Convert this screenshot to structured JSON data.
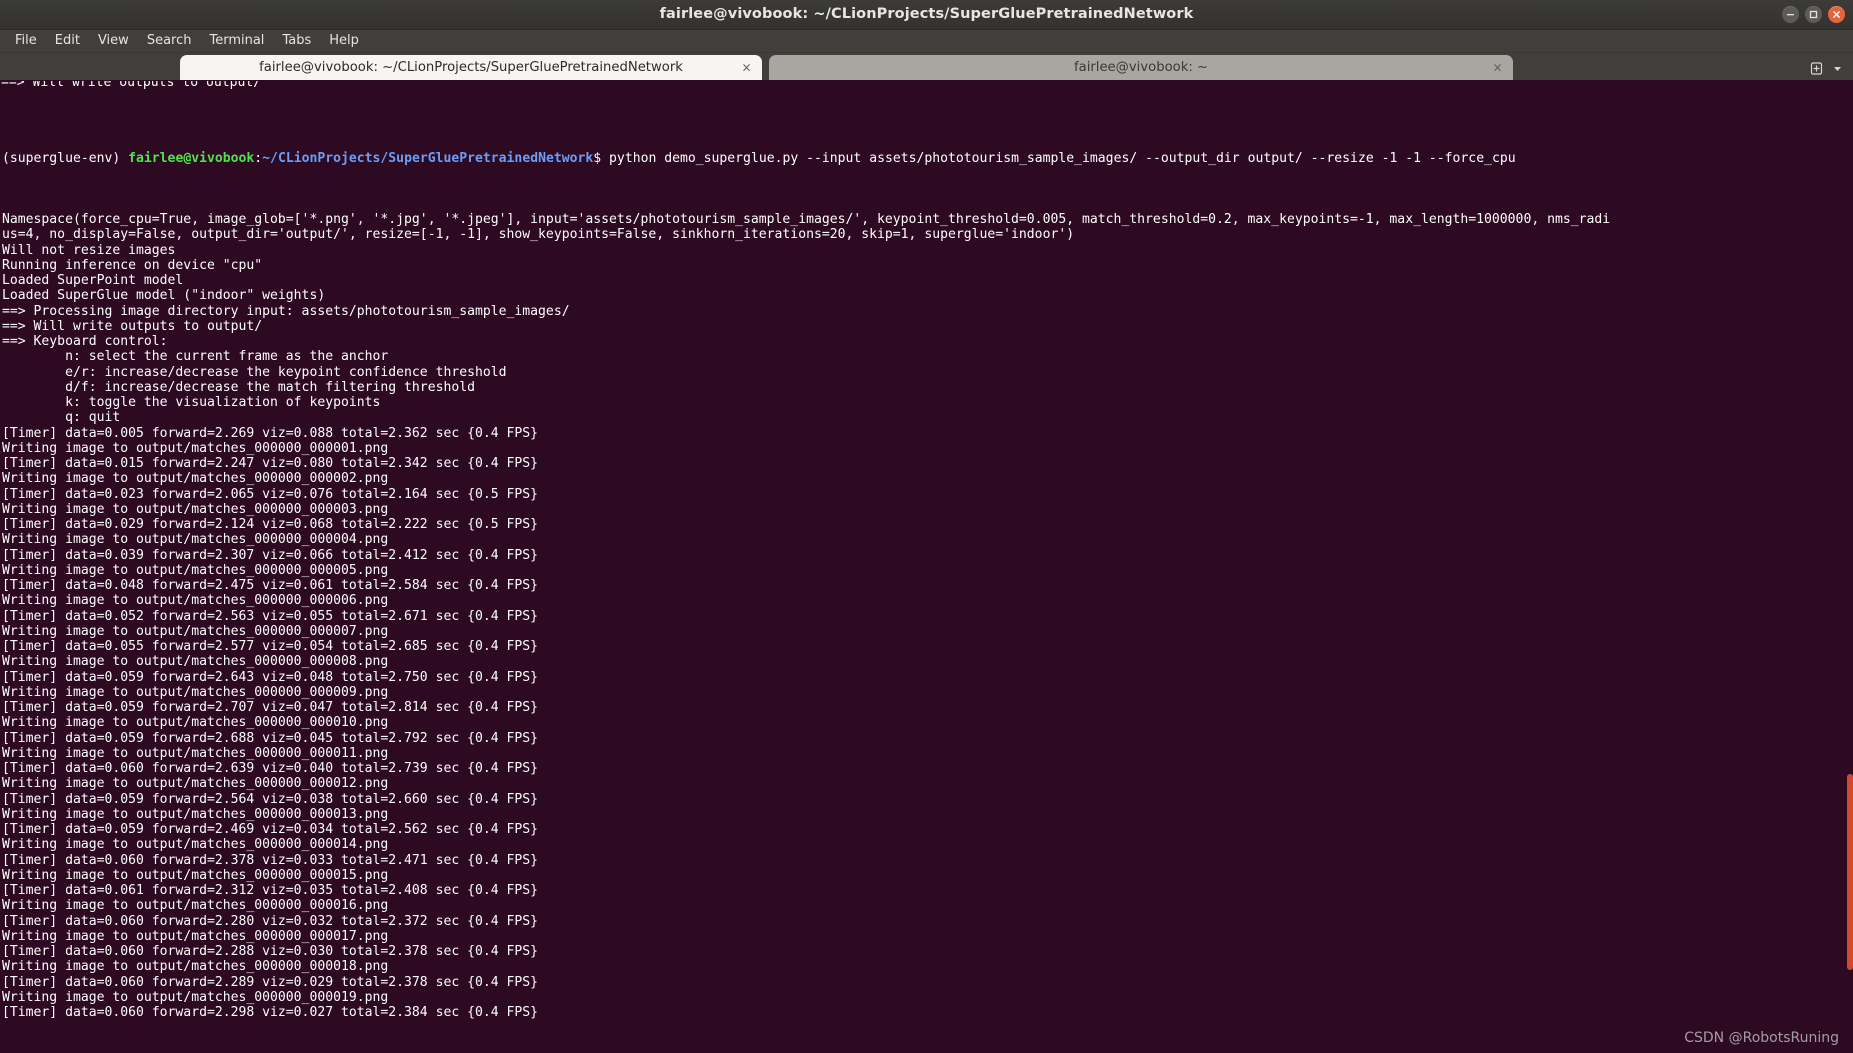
{
  "window": {
    "title": "fairlee@vivobook: ~/CLionProjects/SuperGluePretrainedNetwork",
    "controls": {
      "minimize": "minimize",
      "maximize": "maximize",
      "close": "close"
    }
  },
  "menubar": {
    "items": [
      {
        "label": "File"
      },
      {
        "label": "Edit"
      },
      {
        "label": "View"
      },
      {
        "label": "Search"
      },
      {
        "label": "Terminal"
      },
      {
        "label": "Tabs"
      },
      {
        "label": "Help"
      }
    ]
  },
  "tabs": [
    {
      "label": "fairlee@vivobook: ~/CLionProjects/SuperGluePretrainedNetwork",
      "close": "×",
      "active": true
    },
    {
      "label": "fairlee@vivobook: ~",
      "close": "×",
      "active": false
    }
  ],
  "tabbar_actions": {
    "new_tab": "new-tab",
    "tab_list": "tab-list"
  },
  "terminal": {
    "colors": {
      "background": "#2d0922",
      "foreground": "#ffffff",
      "prompt_user": "#4ee44e",
      "prompt_path": "#6c9ef8",
      "scrollbar": "#d24a2e"
    },
    "cut_top_line": "==> Will write outputs to output/",
    "prompt": {
      "venv": "(superglue-env) ",
      "user_host": "fairlee@vivobook",
      "colon": ":",
      "path": "~/CLionProjects/SuperGluePretrainedNetwork",
      "sigil": "$ ",
      "command": "python demo_superglue.py --input assets/phototourism_sample_images/ --output_dir output/ --resize -1 -1 --force_cpu"
    },
    "lines": [
      "Namespace(force_cpu=True, image_glob=['*.png', '*.jpg', '*.jpeg'], input='assets/phototourism_sample_images/', keypoint_threshold=0.005, match_threshold=0.2, max_keypoints=-1, max_length=1000000, nms_radi",
      "us=4, no_display=False, output_dir='output/', resize=[-1, -1], show_keypoints=False, sinkhorn_iterations=20, skip=1, superglue='indoor')",
      "Will not resize images",
      "Running inference on device \"cpu\"",
      "Loaded SuperPoint model",
      "Loaded SuperGlue model (\"indoor\" weights)",
      "==> Processing image directory input: assets/phototourism_sample_images/",
      "==> Will write outputs to output/",
      "==> Keyboard control:",
      "        n: select the current frame as the anchor",
      "        e/r: increase/decrease the keypoint confidence threshold",
      "        d/f: increase/decrease the match filtering threshold",
      "        k: toggle the visualization of keypoints",
      "        q: quit",
      "[Timer] data=0.005 forward=2.269 viz=0.088 total=2.362 sec {0.4 FPS}",
      "Writing image to output/matches_000000_000001.png",
      "[Timer] data=0.015 forward=2.247 viz=0.080 total=2.342 sec {0.4 FPS}",
      "Writing image to output/matches_000000_000002.png",
      "[Timer] data=0.023 forward=2.065 viz=0.076 total=2.164 sec {0.5 FPS}",
      "Writing image to output/matches_000000_000003.png",
      "[Timer] data=0.029 forward=2.124 viz=0.068 total=2.222 sec {0.5 FPS}",
      "Writing image to output/matches_000000_000004.png",
      "[Timer] data=0.039 forward=2.307 viz=0.066 total=2.412 sec {0.4 FPS}",
      "Writing image to output/matches_000000_000005.png",
      "[Timer] data=0.048 forward=2.475 viz=0.061 total=2.584 sec {0.4 FPS}",
      "Writing image to output/matches_000000_000006.png",
      "[Timer] data=0.052 forward=2.563 viz=0.055 total=2.671 sec {0.4 FPS}",
      "Writing image to output/matches_000000_000007.png",
      "[Timer] data=0.055 forward=2.577 viz=0.054 total=2.685 sec {0.4 FPS}",
      "Writing image to output/matches_000000_000008.png",
      "[Timer] data=0.059 forward=2.643 viz=0.048 total=2.750 sec {0.4 FPS}",
      "Writing image to output/matches_000000_000009.png",
      "[Timer] data=0.059 forward=2.707 viz=0.047 total=2.814 sec {0.4 FPS}",
      "Writing image to output/matches_000000_000010.png",
      "[Timer] data=0.059 forward=2.688 viz=0.045 total=2.792 sec {0.4 FPS}",
      "Writing image to output/matches_000000_000011.png",
      "[Timer] data=0.060 forward=2.639 viz=0.040 total=2.739 sec {0.4 FPS}",
      "Writing image to output/matches_000000_000012.png",
      "[Timer] data=0.059 forward=2.564 viz=0.038 total=2.660 sec {0.4 FPS}",
      "Writing image to output/matches_000000_000013.png",
      "[Timer] data=0.059 forward=2.469 viz=0.034 total=2.562 sec {0.4 FPS}",
      "Writing image to output/matches_000000_000014.png",
      "[Timer] data=0.060 forward=2.378 viz=0.033 total=2.471 sec {0.4 FPS}",
      "Writing image to output/matches_000000_000015.png",
      "[Timer] data=0.061 forward=2.312 viz=0.035 total=2.408 sec {0.4 FPS}",
      "Writing image to output/matches_000000_000016.png",
      "[Timer] data=0.060 forward=2.280 viz=0.032 total=2.372 sec {0.4 FPS}",
      "Writing image to output/matches_000000_000017.png",
      "[Timer] data=0.060 forward=2.288 viz=0.030 total=2.378 sec {0.4 FPS}",
      "Writing image to output/matches_000000_000018.png",
      "[Timer] data=0.060 forward=2.289 viz=0.029 total=2.378 sec {0.4 FPS}",
      "Writing image to output/matches_000000_000019.png",
      "[Timer] data=0.060 forward=2.298 viz=0.027 total=2.384 sec {0.4 FPS}"
    ]
  },
  "watermark": {
    "text": "CSDN @RobotsRuning"
  }
}
